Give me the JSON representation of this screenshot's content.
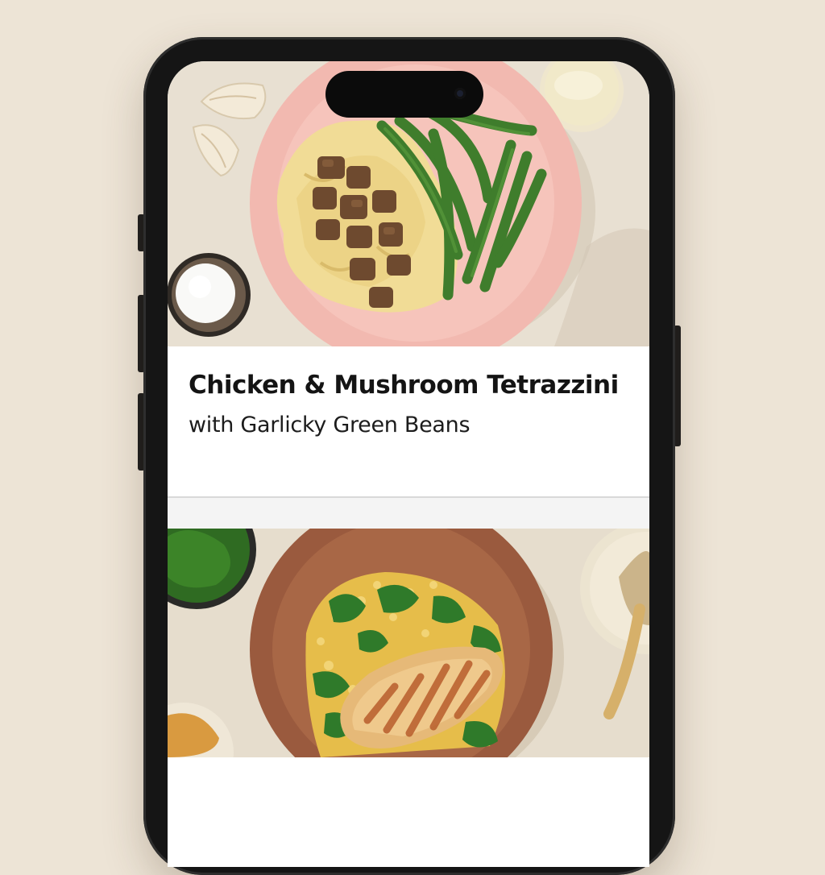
{
  "feed": {
    "items": [
      {
        "title": "Chicken & Mushroom Tetrazzini",
        "subtitle": "with Garlicky Green Beans",
        "photo_icon": "tetrazzini-photo"
      },
      {
        "title": "",
        "subtitle": "",
        "photo_icon": "grilled-chicken-photo"
      }
    ]
  },
  "colors": {
    "background": "#ede4d6",
    "card": "#ffffff",
    "plate_pink": "#f2b9b0",
    "plate_brown": "#9a5a3e",
    "green_beans": "#3f7d2c"
  }
}
